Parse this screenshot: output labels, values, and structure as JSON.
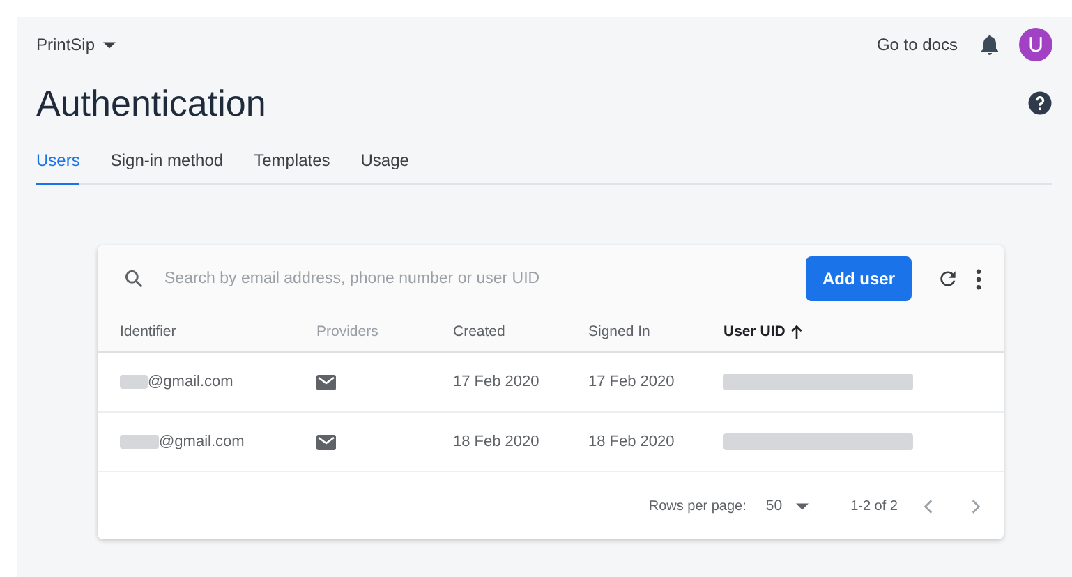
{
  "project": {
    "name": "PrintSip"
  },
  "header": {
    "docs_link": "Go to docs",
    "avatar": "U"
  },
  "title": "Authentication",
  "tabs": [
    {
      "label": "Users",
      "selected": true
    },
    {
      "label": "Sign-in method",
      "selected": false
    },
    {
      "label": "Templates",
      "selected": false
    },
    {
      "label": "Usage",
      "selected": false
    }
  ],
  "search": {
    "placeholder": "Search by email address, phone number or user UID"
  },
  "add_button": "Add user",
  "table": {
    "columns": [
      {
        "label": "Identifier",
        "sortable": true,
        "sorted": false
      },
      {
        "label": "Providers",
        "sortable": false,
        "sorted": false
      },
      {
        "label": "Created",
        "sortable": true,
        "sorted": false
      },
      {
        "label": "Signed In",
        "sortable": true,
        "sorted": false
      },
      {
        "label": "User UID",
        "sortable": true,
        "sorted": true
      }
    ],
    "rows": [
      {
        "identifier": "@gmail.com",
        "created": "17 Feb 2020",
        "signed_in": "17 Feb 2020"
      },
      {
        "identifier": "@gmail.com",
        "created": "18 Feb 2020",
        "signed_in": "18 Feb 2020"
      }
    ]
  },
  "pagination": {
    "rows_per_page_label": "Rows per page:",
    "rows_per_page": "50",
    "range": "1-2 of 2"
  }
}
